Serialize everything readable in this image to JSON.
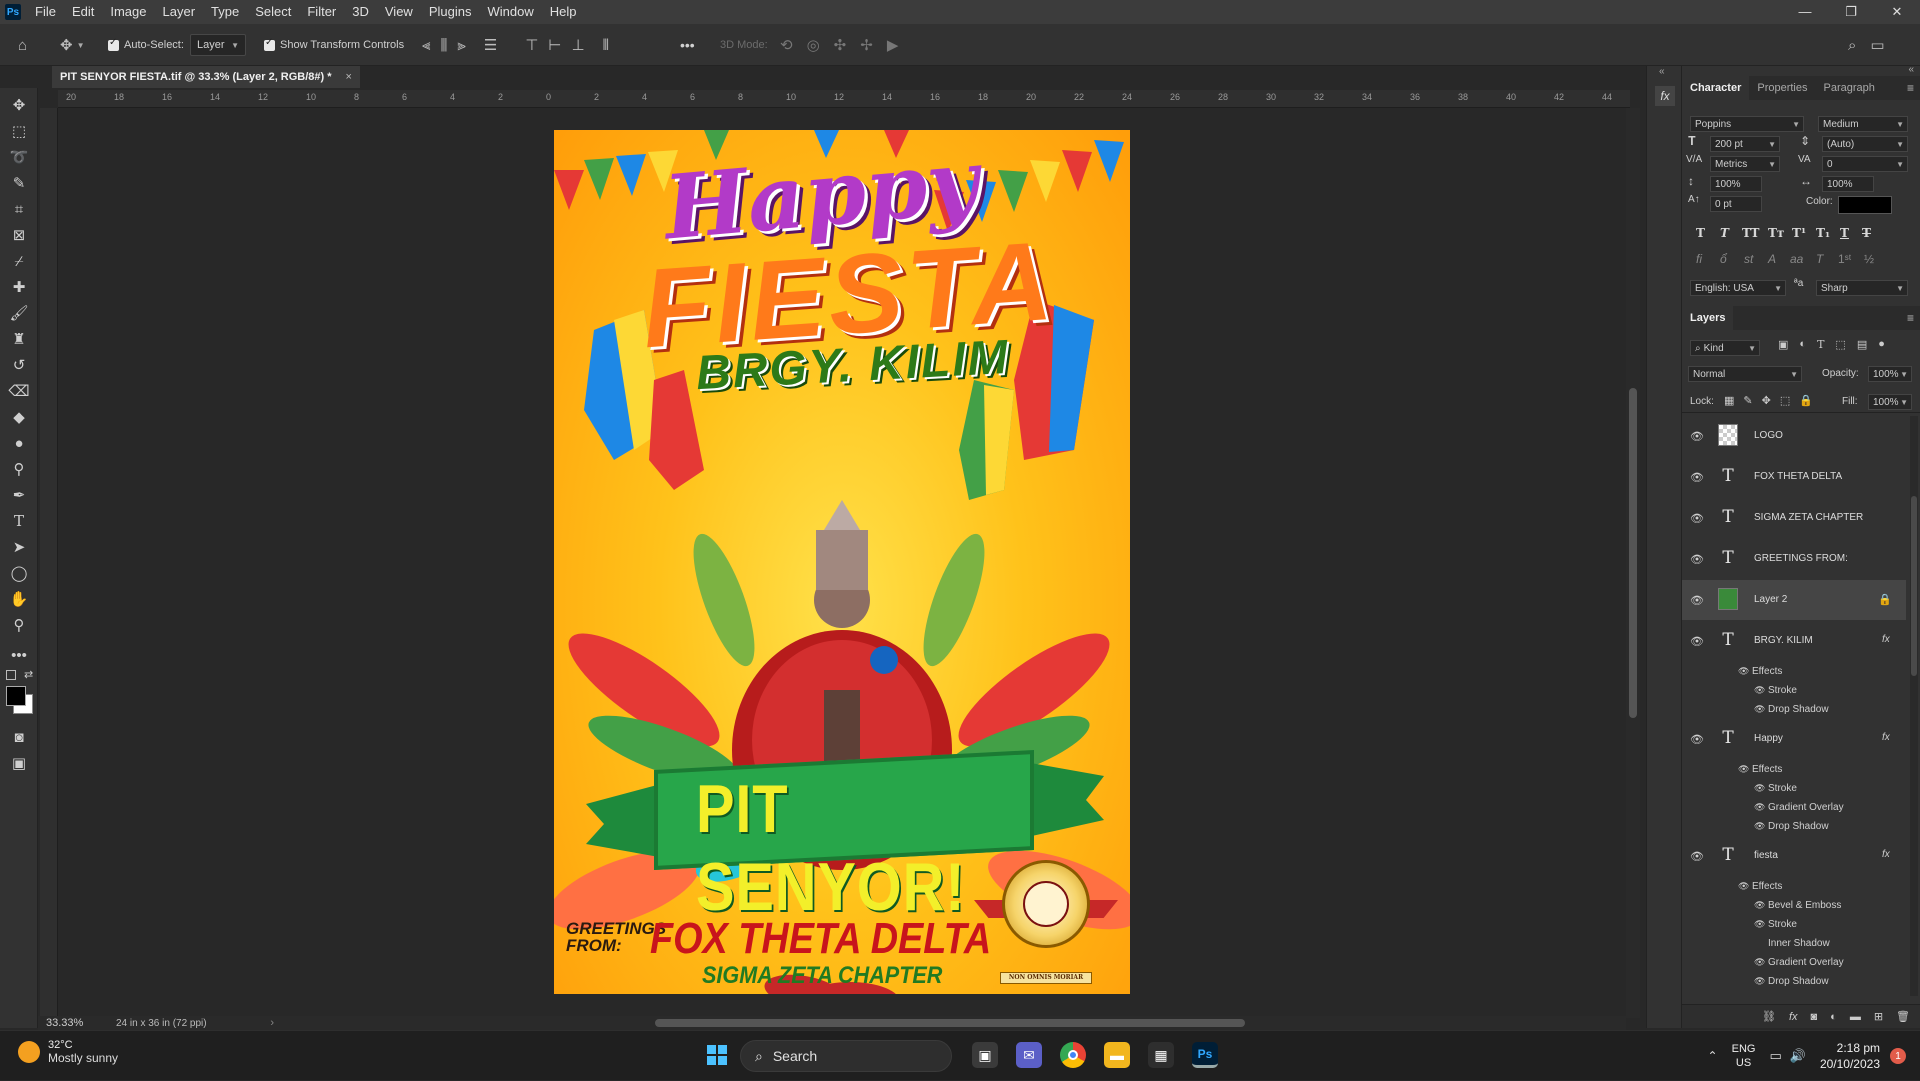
{
  "menubar": {
    "app_logo": "Ps",
    "items": [
      "File",
      "Edit",
      "Image",
      "Layer",
      "Type",
      "Select",
      "Filter",
      "3D",
      "View",
      "Plugins",
      "Window",
      "Help"
    ]
  },
  "options": {
    "auto_select_label": "Auto-Select:",
    "auto_select_value": "Layer",
    "show_transform_label": "Show Transform Controls",
    "mode_3d_label": "3D Mode:",
    "more": "•••"
  },
  "document": {
    "tab_title": "PIT SENYOR FIESTA.tif @ 33.3% (Layer 2, RGB/8#) *",
    "zoom": "33.33%",
    "doc_info": "24 in x 36 in (72 ppi)"
  },
  "ruler": {
    "top_ticks": [
      "20",
      "18",
      "16",
      "14",
      "12",
      "10",
      "8",
      "6",
      "4",
      "2",
      "0",
      "2",
      "4",
      "6",
      "8",
      "10",
      "12",
      "14",
      "16",
      "18",
      "20",
      "22",
      "24",
      "26",
      "28",
      "30",
      "32",
      "34",
      "36",
      "38",
      "40",
      "42",
      "44"
    ]
  },
  "poster": {
    "happy": "Happy",
    "fiesta": "FIESTA",
    "brgy": "BRGY. KILIM",
    "pit_senyor": "PIT SENYOR!",
    "greetings_line1": "GREETINGS",
    "greetings_line2": "FROM:",
    "fox": "FOX THETA DELTA",
    "sigma": "SIGMA ZETA CHAPTER",
    "seal_motto": "NON OMNIS MORIAR"
  },
  "character_panel": {
    "tabs": [
      "Character",
      "Properties",
      "Paragraph"
    ],
    "font_family": "Poppins",
    "font_style": "Medium",
    "font_size": "200 pt",
    "leading": "(Auto)",
    "kerning": "Metrics",
    "tracking": "0",
    "vertical_scale": "100%",
    "horizontal_scale": "100%",
    "baseline_shift": "0 pt",
    "color_label": "Color:",
    "color_value": "#000000",
    "language": "English: USA",
    "antialias": "Sharp"
  },
  "layers_panel": {
    "title": "Layers",
    "filter": "Kind",
    "blend_mode": "Normal",
    "opacity_label": "Opacity:",
    "opacity": "100%",
    "lock_label": "Lock:",
    "fill_label": "Fill:",
    "fill": "100%",
    "layers": [
      {
        "name": "LOGO",
        "kind": "image"
      },
      {
        "name": "FOX THETA DELTA",
        "kind": "text"
      },
      {
        "name": "SIGMA ZETA CHAPTER",
        "kind": "text"
      },
      {
        "name": "GREETINGS  FROM:",
        "kind": "text"
      },
      {
        "name": "Layer 2",
        "kind": "image",
        "selected": true,
        "locked": true
      },
      {
        "name": "BRGY. KILIM",
        "kind": "text",
        "fx": true,
        "effects": [
          "Stroke",
          "Drop Shadow"
        ]
      },
      {
        "name": "Happy",
        "kind": "text",
        "fx": true,
        "effects": [
          "Stroke",
          "Gradient Overlay",
          "Drop Shadow"
        ]
      },
      {
        "name": "fiesta",
        "kind": "text",
        "fx": true,
        "effects": [
          "Bevel & Emboss",
          "Stroke",
          "Inner Shadow",
          "Gradient Overlay",
          "Drop Shadow"
        ]
      }
    ],
    "effects_label": "Effects"
  },
  "taskbar": {
    "weather_temp": "32°C",
    "weather_desc": "Mostly sunny",
    "search_label": "Search",
    "lang_line1": "ENG",
    "lang_line2": "US",
    "time": "2:18 pm",
    "date": "20/10/2023",
    "notification_count": "1"
  }
}
